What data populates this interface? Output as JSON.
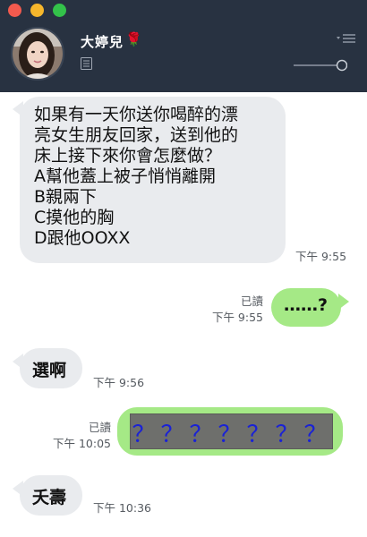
{
  "window": {
    "controls": [
      "close",
      "minimize",
      "zoom"
    ]
  },
  "header": {
    "contact_name": "大婷兒",
    "contact_emoji": "🌹",
    "avatar_icon": "avatar-photo",
    "notes_icon": "notes-icon",
    "menu_icon": "menu-icon",
    "slider_icon": "slider-icon",
    "bg_color": "#283241"
  },
  "messages": [
    {
      "direction": "incoming",
      "lines": [
        "如果有一天你送你喝醉的漂",
        "亮女生朋友回家，送到他的",
        "床上接下來你會怎麼做？",
        "A幫他蓋上被子悄悄離開",
        "B親兩下",
        "C摸他的胸",
        "D跟他OOXX"
      ],
      "time": "下午 9:55"
    },
    {
      "direction": "outgoing",
      "text": "……?",
      "read": "已讀",
      "time": "下午 9:55"
    },
    {
      "direction": "incoming",
      "text": "選啊",
      "time": "下午 9:56"
    },
    {
      "direction": "outgoing",
      "text": "？？？？？？？",
      "read": "已讀",
      "time": "下午 10:05"
    },
    {
      "direction": "incoming",
      "text": "夭壽",
      "time": "下午 10:36"
    }
  ],
  "colors": {
    "incoming_bubble": "#e9ebee",
    "outgoing_bubble": "#a5e986",
    "question_marks": "#1a22d6",
    "question_box": "#6e6f6c"
  }
}
